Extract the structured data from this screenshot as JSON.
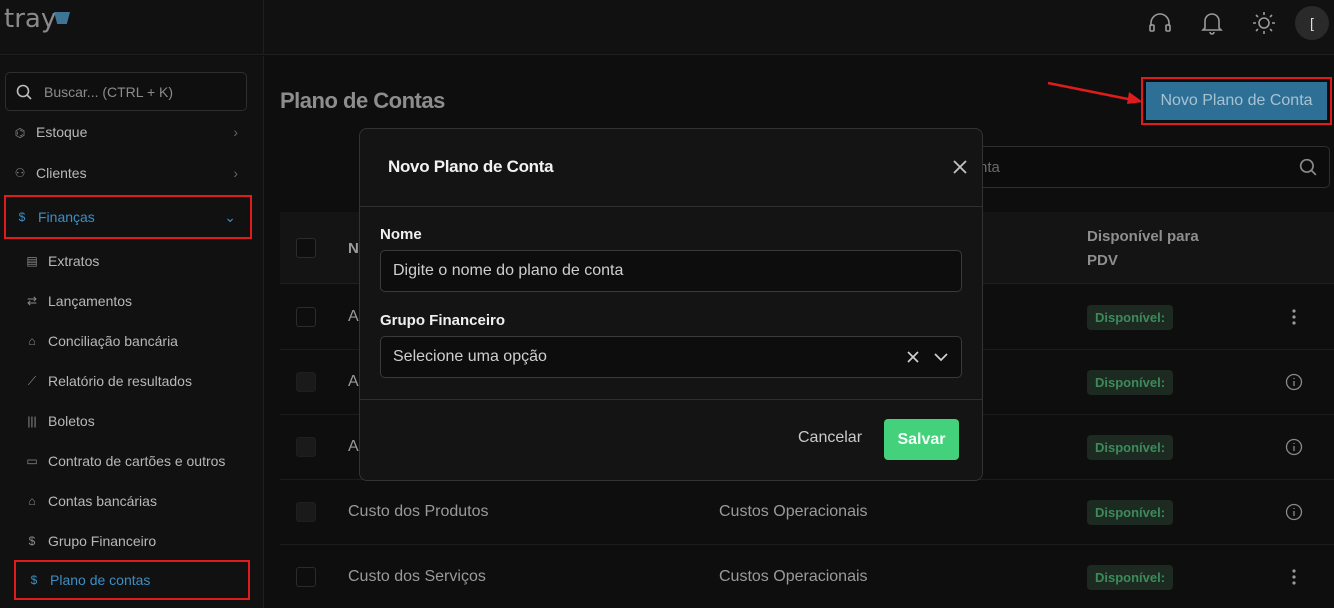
{
  "app": {
    "logo_text": "tray"
  },
  "topbar": {
    "icons": [
      "headset-icon",
      "bell-icon",
      "sun-icon"
    ],
    "avatar_text": "["
  },
  "sidebar": {
    "search_placeholder": "Buscar... (CTRL + K)",
    "items": [
      {
        "label": "Estoque",
        "icon": "box-icon"
      },
      {
        "label": "Clientes",
        "icon": "users-icon"
      },
      {
        "label": "Finanças",
        "icon": "dollar-icon",
        "active": true,
        "expanded": true
      }
    ],
    "sub_items": [
      {
        "label": "Extratos"
      },
      {
        "label": "Lançamentos"
      },
      {
        "label": "Conciliação bancária"
      },
      {
        "label": "Relatório de resultados"
      },
      {
        "label": "Boletos"
      },
      {
        "label": "Contrato de cartões e outros"
      },
      {
        "label": "Contas bancárias"
      },
      {
        "label": "Grupo Financeiro"
      },
      {
        "label": "Plano de contas",
        "active": true
      }
    ]
  },
  "page": {
    "title": "Plano de Contas",
    "new_button": "Novo Plano de Conta",
    "search_placeholder_visible": "nta"
  },
  "table": {
    "headers": {
      "name": "N",
      "pdv": "Disponível para PDV"
    },
    "rows": [
      {
        "name": "A",
        "group": "",
        "pdv": "Disponível:",
        "action": "kebab"
      },
      {
        "name": "A",
        "group": "",
        "pdv": "Disponível:",
        "action": "info"
      },
      {
        "name": "A",
        "group": "",
        "pdv": "Disponível:",
        "action": "info"
      },
      {
        "name": "Custo dos Produtos",
        "group": "Custos Operacionais",
        "pdv": "Disponível:",
        "action": "info"
      },
      {
        "name": "Custo dos Serviços",
        "group": "Custos Operacionais",
        "pdv": "Disponível:",
        "action": "kebab"
      }
    ]
  },
  "modal": {
    "title": "Novo Plano de Conta",
    "name_label": "Nome",
    "name_placeholder": "Digite o nome do plano de conta",
    "group_label": "Grupo Financeiro",
    "group_placeholder": "Selecione uma opção",
    "cancel_label": "Cancelar",
    "save_label": "Salvar"
  },
  "colors": {
    "accent": "#3b8fc4",
    "highlight": "#e01b1b",
    "save": "#43d17b",
    "badge_text": "#3d8a5b"
  }
}
